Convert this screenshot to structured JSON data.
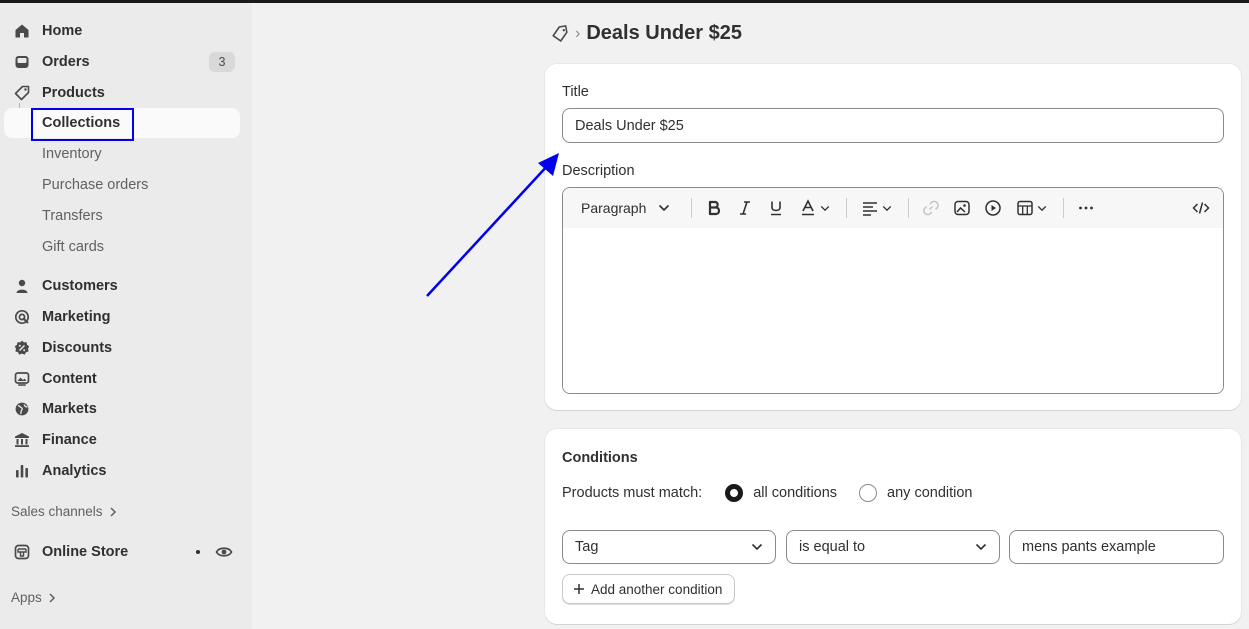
{
  "sidebar": {
    "primary": [
      {
        "label": "Home",
        "icon": "home-icon"
      },
      {
        "label": "Orders",
        "icon": "orders-icon",
        "badge": "3"
      },
      {
        "label": "Products",
        "icon": "tag-icon"
      }
    ],
    "products_sub": [
      {
        "label": "Collections",
        "active": true
      },
      {
        "label": "Inventory"
      },
      {
        "label": "Purchase orders"
      },
      {
        "label": "Transfers"
      },
      {
        "label": "Gift cards"
      }
    ],
    "secondary": [
      {
        "label": "Customers",
        "icon": "person-icon"
      },
      {
        "label": "Marketing",
        "icon": "target-icon"
      },
      {
        "label": "Discounts",
        "icon": "discount-icon"
      },
      {
        "label": "Content",
        "icon": "image-icon"
      },
      {
        "label": "Markets",
        "icon": "globe-icon"
      },
      {
        "label": "Finance",
        "icon": "bank-icon"
      },
      {
        "label": "Analytics",
        "icon": "bar-chart-icon"
      }
    ],
    "sales_channels_label": "Sales channels",
    "online_store_label": "Online Store",
    "apps_label": "Apps"
  },
  "header": {
    "title": "Deals Under $25"
  },
  "details": {
    "title_label": "Title",
    "title_value": "Deals Under $25",
    "description_label": "Description",
    "paragraph_label": "Paragraph"
  },
  "conditions": {
    "heading": "Conditions",
    "match_label": "Products must match:",
    "option_all": "all conditions",
    "option_any": "any condition",
    "selected": "all",
    "rule": {
      "field": "Tag",
      "operator": "is equal to",
      "value": "mens pants example"
    },
    "add_label": "Add another condition"
  },
  "colors": {
    "annotation": "#0000ee",
    "sidebar_bg": "#ebebeb",
    "page_bg": "#f1f1f1"
  }
}
